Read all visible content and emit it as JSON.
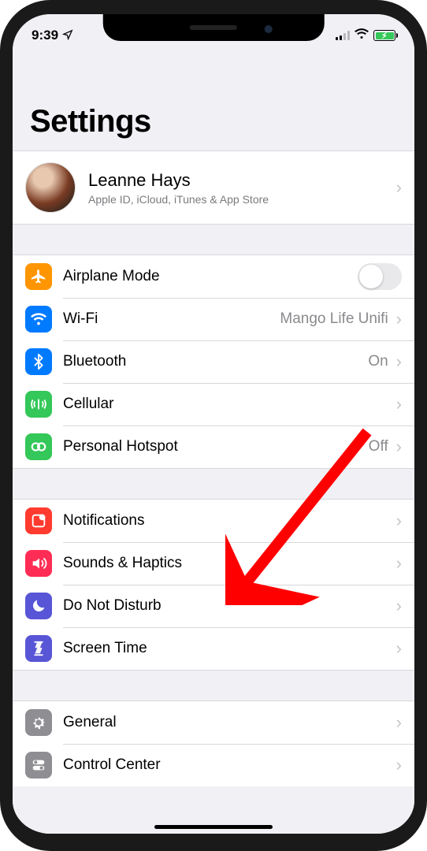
{
  "status": {
    "time": "9:39",
    "signal_bars_filled": 2
  },
  "header": {
    "title": "Settings"
  },
  "profile": {
    "name": "Leanne Hays",
    "subtitle": "Apple ID, iCloud, iTunes & App Store"
  },
  "groups": [
    {
      "rows": [
        {
          "id": "airplane",
          "label": "Airplane Mode",
          "icon": "airplane-icon",
          "color": "#ff9500",
          "control": "toggle",
          "toggle_on": false
        },
        {
          "id": "wifi",
          "label": "Wi-Fi",
          "icon": "wifi-icon",
          "color": "#007aff",
          "value": "Mango Life Unifi",
          "chevron": true
        },
        {
          "id": "bluetooth",
          "label": "Bluetooth",
          "icon": "bluetooth-icon",
          "color": "#007aff",
          "value": "On",
          "chevron": true
        },
        {
          "id": "cellular",
          "label": "Cellular",
          "icon": "cellular-icon",
          "color": "#34c759",
          "chevron": true
        },
        {
          "id": "hotspot",
          "label": "Personal Hotspot",
          "icon": "hotspot-icon",
          "color": "#34c759",
          "value": "Off",
          "chevron": true
        }
      ]
    },
    {
      "rows": [
        {
          "id": "notifications",
          "label": "Notifications",
          "icon": "notifications-icon",
          "color": "#ff3b30",
          "chevron": true
        },
        {
          "id": "sounds",
          "label": "Sounds & Haptics",
          "icon": "sounds-icon",
          "color": "#ff2d55",
          "chevron": true
        },
        {
          "id": "dnd",
          "label": "Do Not Disturb",
          "icon": "dnd-icon",
          "color": "#5856d6",
          "chevron": true
        },
        {
          "id": "screentime",
          "label": "Screen Time",
          "icon": "screentime-icon",
          "color": "#5856d6",
          "chevron": true
        }
      ]
    },
    {
      "rows": [
        {
          "id": "general",
          "label": "General",
          "icon": "general-icon",
          "color": "#8e8e93",
          "chevron": true
        },
        {
          "id": "control",
          "label": "Control Center",
          "icon": "control-icon",
          "color": "#8e8e93",
          "chevron": true
        }
      ]
    }
  ],
  "annotation": {
    "points_to": "sounds"
  }
}
